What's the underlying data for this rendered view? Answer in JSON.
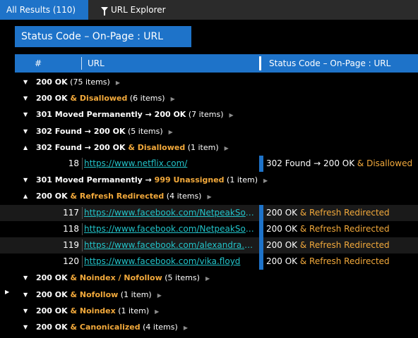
{
  "tabs": {
    "all_results": "All Results (110)",
    "url_explorer": "URL Explorer"
  },
  "group_by": "Status Code  –  On-Page  :  URL",
  "columns": {
    "num": "#",
    "url": "URL",
    "status": "Status Code  –  On-Page  :  URL"
  },
  "groups": [
    {
      "expanded": false,
      "bold": "200 OK",
      "highlight": "",
      "count": "(75 items)",
      "rows": []
    },
    {
      "expanded": false,
      "bold": "200 OK",
      "highlight": " & Disallowed",
      "count": "(6 items)",
      "rows": []
    },
    {
      "expanded": false,
      "bold": "301 Moved Permanently → 200 OK",
      "highlight": "",
      "count": "(7 items)",
      "rows": []
    },
    {
      "expanded": false,
      "bold": "302 Found → 200 OK",
      "highlight": "",
      "count": "(5 items)",
      "rows": []
    },
    {
      "expanded": true,
      "bold": "302 Found → 200 OK",
      "highlight": " & Disallowed",
      "count": "(1 item)",
      "rows": [
        {
          "num": "18",
          "url": "https://www.netflix.com/",
          "status_main": "302 Found → 200 OK",
          "status_extra": " & Disallowed",
          "shade": false
        }
      ]
    },
    {
      "expanded": false,
      "bold": "301 Moved Permanently → ",
      "highlight": "999 Unassigned",
      "count": "(1 item)",
      "rows": []
    },
    {
      "expanded": true,
      "bold": "200 OK",
      "highlight": " & Refresh Redirected",
      "count": "(4 items)",
      "rows": [
        {
          "num": "117",
          "url": "https://www.facebook.com/NetpeakSoftware",
          "status_main": "200 OK",
          "status_extra": " & Refresh Redirected",
          "shade": true
        },
        {
          "num": "118",
          "url": "https://www.facebook.com/NetpeakSoftware",
          "status_main": "200 OK",
          "status_extra": " & Refresh Redirected",
          "shade": false
        },
        {
          "num": "119",
          "url": "https://www.facebook.com/alexandra.marchenko",
          "status_main": "200 OK",
          "status_extra": " & Refresh Redirected",
          "shade": true
        },
        {
          "num": "120",
          "url": "https://www.facebook.com/vika.floyd",
          "status_main": "200 OK",
          "status_extra": " & Refresh Redirected",
          "shade": false
        }
      ]
    },
    {
      "expanded": false,
      "bold": "200 OK",
      "highlight": " & Noindex / Nofollow",
      "count": "(5 items)",
      "rows": []
    },
    {
      "expanded": false,
      "bold": "200 OK",
      "highlight": " & Nofollow",
      "count": "(1 item)",
      "rows": []
    },
    {
      "expanded": false,
      "bold": "200 OK",
      "highlight": " & Noindex",
      "count": "(1 item)",
      "rows": []
    },
    {
      "expanded": false,
      "bold": "200 OK",
      "highlight": " & Canonicalized",
      "count": "(4 items)",
      "rows": []
    }
  ]
}
